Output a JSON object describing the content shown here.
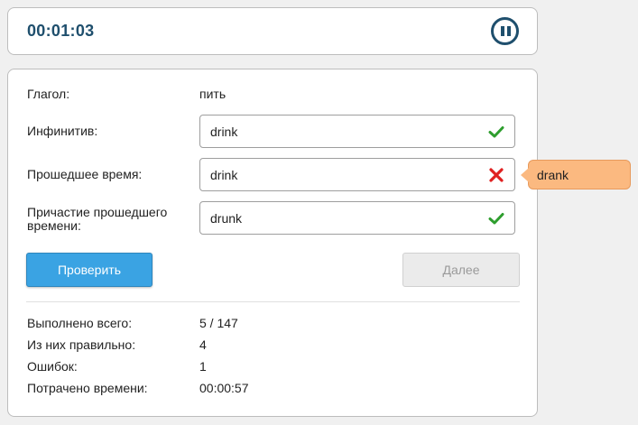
{
  "timer": {
    "elapsed": "00:01:03",
    "icon": "pause-icon"
  },
  "verb": {
    "label": "Глагол:",
    "value": "пить"
  },
  "fields": [
    {
      "label": "Инфинитив:",
      "value": "drink",
      "status": "correct"
    },
    {
      "label": "Прошедшее время:",
      "value": "drink",
      "status": "incorrect"
    },
    {
      "label_line1": "Причастие прошедшего",
      "label_line2": "времени:",
      "value": "drunk",
      "status": "correct"
    }
  ],
  "buttons": {
    "check": "Проверить",
    "next": "Далее"
  },
  "tooltip": {
    "text": "drank"
  },
  "stats": [
    {
      "label": "Выполнено всего:",
      "value": "5 / 147"
    },
    {
      "label": "Из них правильно:",
      "value": "4"
    },
    {
      "label": "Ошибок:",
      "value": "1"
    },
    {
      "label": "Потрачено времени:",
      "value": "00:00:57"
    }
  ],
  "colors": {
    "accent": "#3aa3e3",
    "timer_text": "#1f4f6d",
    "correct": "#2e9e2e",
    "incorrect": "#e02020",
    "tooltip_bg": "#fbb980"
  }
}
